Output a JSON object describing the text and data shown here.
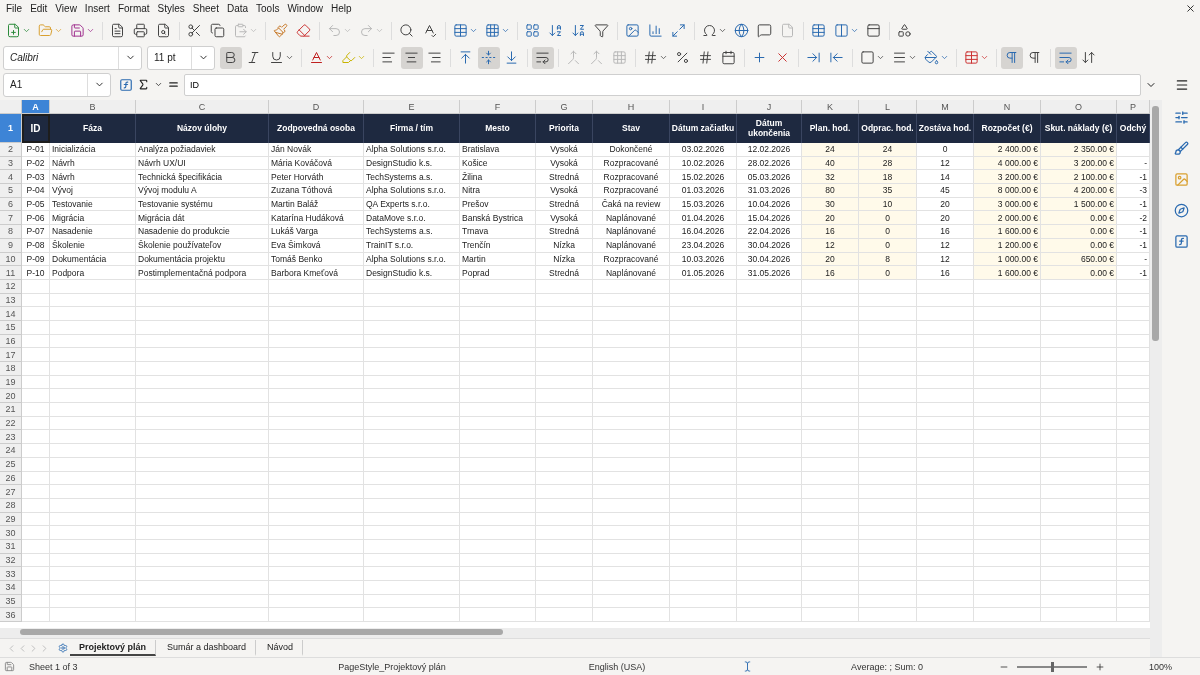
{
  "menu": [
    "File",
    "Edit",
    "View",
    "Insert",
    "Format",
    "Styles",
    "Sheet",
    "Data",
    "Tools",
    "Window",
    "Help"
  ],
  "format_toolbar": {
    "font": "Calibri",
    "size": "11 pt",
    "bold": true,
    "italic": false,
    "underline": false,
    "align_left": false,
    "align_center": true,
    "align_right": false,
    "align_top": false,
    "align_middle": true,
    "align_bottom": false,
    "wrap": true,
    "left_to_right": true,
    "right_to_left": false
  },
  "formula_bar": {
    "cell": "A1",
    "content": "ID"
  },
  "columns": [
    {
      "letter": "A",
      "selected": true,
      "tinted": false
    },
    {
      "letter": "B",
      "selected": false,
      "tinted": false
    },
    {
      "letter": "C",
      "selected": false,
      "tinted": false
    },
    {
      "letter": "D",
      "selected": false,
      "tinted": false
    },
    {
      "letter": "E",
      "selected": false,
      "tinted": false
    },
    {
      "letter": "F",
      "selected": false,
      "tinted": false
    },
    {
      "letter": "G",
      "selected": false,
      "tinted": false
    },
    {
      "letter": "H",
      "selected": false,
      "tinted": false
    },
    {
      "letter": "I",
      "selected": false,
      "tinted": false
    },
    {
      "letter": "J",
      "selected": false,
      "tinted": false
    },
    {
      "letter": "K",
      "selected": false,
      "tinted": true
    },
    {
      "letter": "L",
      "selected": false,
      "tinted": true
    },
    {
      "letter": "M",
      "selected": false,
      "tinted": false
    },
    {
      "letter": "N",
      "selected": false,
      "tinted": true
    },
    {
      "letter": "O",
      "selected": false,
      "tinted": true
    },
    {
      "letter": "P",
      "selected": false,
      "tinted": false
    }
  ],
  "header_row": {
    "number": "1",
    "selected": true,
    "cells": [
      "ID",
      "Fáza",
      "Názov úlohy",
      "Zodpovedná osoba",
      "Firma / tím",
      "Mesto",
      "Priorita",
      "Stav",
      "Dátum začiatku",
      "Dátum ukončenia",
      "Plan. hod.",
      "Odprac. hod.",
      "Zostáva hod.",
      "Rozpočet (€)",
      "Skut. náklady (€)",
      "Odchý"
    ]
  },
  "rows": [
    {
      "number": "2",
      "cells": [
        "P-01",
        "Inicializácia",
        "Analýza požiadaviek",
        "Ján Novák",
        "Alpha Solutions s.r.o.",
        "Bratislava",
        "Vysoká",
        "Dokončené",
        "03.02.2026",
        "12.02.2026",
        "24",
        "24",
        "0",
        "2 400.00 €",
        "2 350.00 €"
      ]
    },
    {
      "number": "3",
      "cells": [
        "P-02",
        "Návrh",
        "Návrh UX/UI",
        "Mária Kováčová",
        "DesignStudio k.s.",
        "Košice",
        "Vysoká",
        "Rozpracované",
        "10.02.2026",
        "28.02.2026",
        "40",
        "28",
        "12",
        "4 000.00 €",
        "3 200.00 €",
        "-"
      ]
    },
    {
      "number": "4",
      "cells": [
        "P-03",
        "Návrh",
        "Technická špecifikácia",
        "Peter Horváth",
        "TechSystems a.s.",
        "Žilina",
        "Stredná",
        "Rozpracované",
        "15.02.2026",
        "05.03.2026",
        "32",
        "18",
        "14",
        "3 200.00 €",
        "2 100.00 €",
        "-1"
      ]
    },
    {
      "number": "5",
      "cells": [
        "P-04",
        "Vývoj",
        "Vývoj modulu A",
        "Zuzana Tóthová",
        "Alpha Solutions s.r.o.",
        "Nitra",
        "Vysoká",
        "Rozpracované",
        "01.03.2026",
        "31.03.2026",
        "80",
        "35",
        "45",
        "8 000.00 €",
        "4 200.00 €",
        "-3"
      ]
    },
    {
      "number": "6",
      "cells": [
        "P-05",
        "Testovanie",
        "Testovanie systému",
        "Martin Baláž",
        "QA Experts s.r.o.",
        "Prešov",
        "Stredná",
        "Čaká na review",
        "15.03.2026",
        "10.04.2026",
        "30",
        "10",
        "20",
        "3 000.00 €",
        "1 500.00 €",
        "-1"
      ]
    },
    {
      "number": "7",
      "cells": [
        "P-06",
        "Migrácia",
        "Migrácia dát",
        "Katarína Hudáková",
        "DataMove s.r.o.",
        "Banská Bystrica",
        "Vysoká",
        "Naplánované",
        "01.04.2026",
        "15.04.2026",
        "20",
        "0",
        "20",
        "2 000.00 €",
        "0.00 €",
        "-2"
      ]
    },
    {
      "number": "8",
      "cells": [
        "P-07",
        "Nasadenie",
        "Nasadenie do produkcie",
        "Lukáš Varga",
        "TechSystems a.s.",
        "Trnava",
        "Stredná",
        "Naplánované",
        "16.04.2026",
        "22.04.2026",
        "16",
        "0",
        "16",
        "1 600.00 €",
        "0.00 €",
        "-1"
      ]
    },
    {
      "number": "9",
      "cells": [
        "P-08",
        "Školenie",
        "Školenie používateľov",
        "Eva Šimková",
        "TrainIT s.r.o.",
        "Trenčín",
        "Nízka",
        "Naplánované",
        "23.04.2026",
        "30.04.2026",
        "12",
        "0",
        "12",
        "1 200.00 €",
        "0.00 €",
        "-1"
      ]
    },
    {
      "number": "10",
      "cells": [
        "P-09",
        "Dokumentácia",
        "Dokumentácia projektu",
        "Tomáš Benko",
        "Alpha Solutions s.r.o.",
        "Martin",
        "Nízka",
        "Rozpracované",
        "10.03.2026",
        "30.04.2026",
        "20",
        "8",
        "12",
        "1 000.00 €",
        "650.00 €",
        "-"
      ]
    },
    {
      "number": "11",
      "cells": [
        "P-10",
        "Podpora",
        "Postimplementačná podpora",
        "Barbora Kmeťová",
        "DesignStudio k.s.",
        "Poprad",
        "Stredná",
        "Naplánované",
        "01.05.2026",
        "31.05.2026",
        "16",
        "0",
        "16",
        "1 600.00 €",
        "0.00 €",
        "-1"
      ]
    }
  ],
  "empty_rows": [
    "12",
    "13",
    "14",
    "15",
    "16",
    "17",
    "18",
    "19",
    "20",
    "21",
    "22",
    "23",
    "24",
    "25",
    "26",
    "27",
    "28",
    "29",
    "30",
    "31",
    "32",
    "33",
    "34",
    "35",
    "36"
  ],
  "sheet_tabs": [
    {
      "label": "Projektový plán",
      "selected": true
    },
    {
      "label": "Sumár a dashboard",
      "selected": false
    },
    {
      "label": "Návod",
      "selected": false
    }
  ],
  "status_bar": {
    "sheet": "Sheet 1 of 3",
    "page_style": "PageStyle_Projektový plán",
    "language": "English (USA)",
    "summary": "Average: ; Sum: 0",
    "zoom": "100%",
    "zoom_slider": {
      "level": 0.5
    }
  }
}
